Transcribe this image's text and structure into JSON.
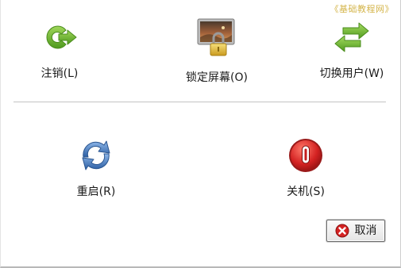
{
  "watermark": "《基础教程网》",
  "actions": {
    "logout": {
      "label": "注销(L)",
      "icon": "logout-arrow-icon"
    },
    "lock": {
      "label": "锁定屏幕(O)",
      "icon": "lock-screen-icon"
    },
    "switch_user": {
      "label": "切换用户(W)",
      "icon": "switch-user-arrows-icon"
    },
    "restart": {
      "label": "重启(R)",
      "icon": "restart-arrows-icon"
    },
    "shutdown": {
      "label": "关机(S)",
      "icon": "power-icon"
    }
  },
  "cancel": {
    "label": "取消",
    "icon": "cancel-x-icon"
  },
  "colors": {
    "green_icon": "#6fb52c",
    "blue_icon": "#3f74b8",
    "red_icon": "#d42222",
    "lock_gold": "#e3c23c",
    "watermark": "#d4b54a"
  }
}
